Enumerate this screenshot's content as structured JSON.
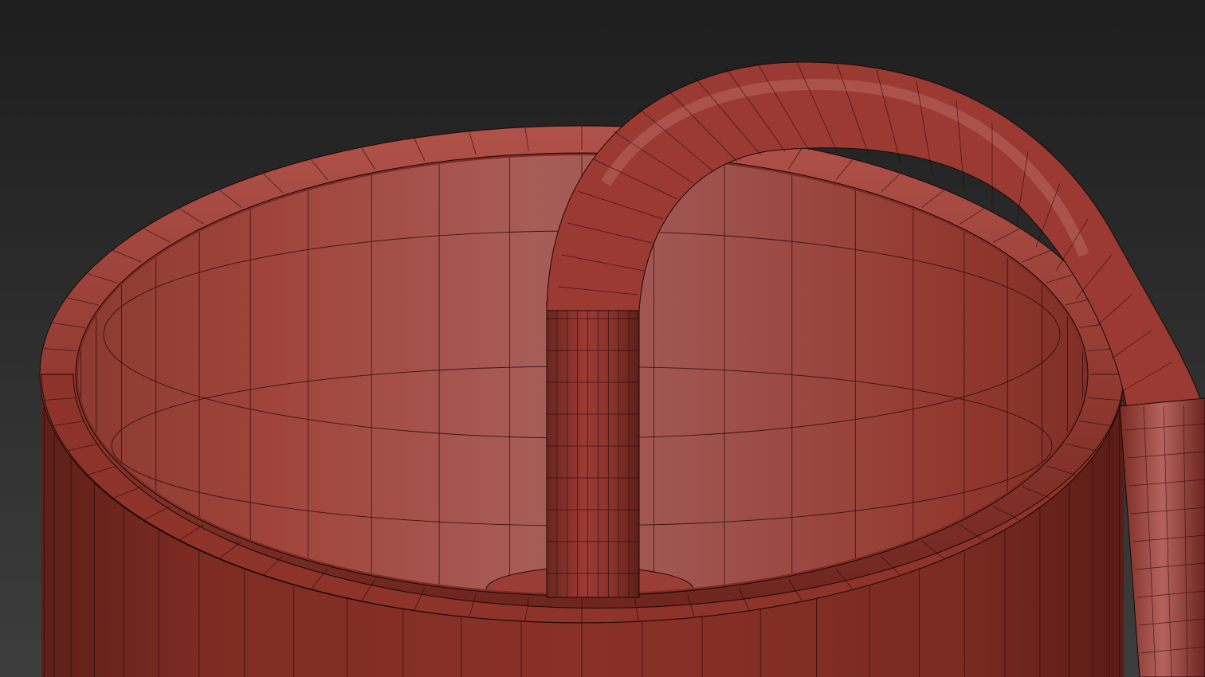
{
  "viewport": {
    "kind": "3d-viewport",
    "shading": "shaded-with-wireframe",
    "background_top": "#1e1e1e",
    "background_bottom": "#3c3c3c"
  },
  "model": {
    "object": "red-cylinder-with-bent-pipe",
    "base_color": "#a0473f",
    "inner_wall_light": "#a8605a",
    "inner_wall_dark": "#8f3b33",
    "outer_wall_color": "#7a2a22",
    "wire_color": "#1a0a08"
  }
}
